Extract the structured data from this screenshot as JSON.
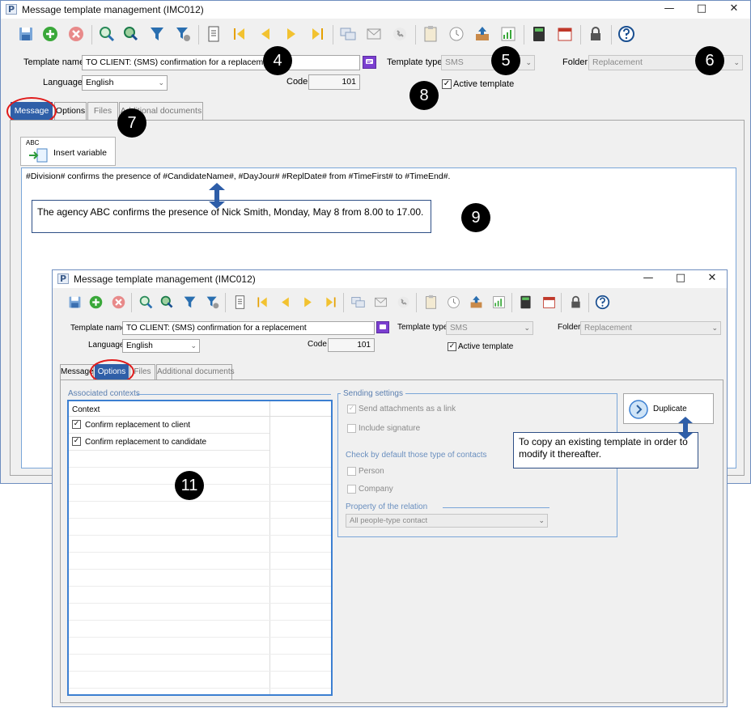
{
  "window1": {
    "title": "Message template management (IMC012)",
    "form": {
      "template_name_label": "Template name",
      "template_name_value": "TO CLIENT: (SMS) confirmation for a replacement",
      "template_type_label": "Template type",
      "template_type_value": "SMS",
      "folder_label": "Folder",
      "folder_value": "Replacement",
      "language_label": "Language",
      "language_value": "English",
      "code_label": "Code",
      "code_value": "101",
      "active_label": "Active template"
    },
    "tabs": [
      "Message",
      "Options",
      "Files",
      "Additional documents"
    ],
    "insert_variable_label": "Insert variable",
    "insert_variable_icon_text": "ABC",
    "message_text": "#Division# confirms the presence of #CandidateName#, #DayJour# #ReplDate# from #TimeFirst# to #TimeEnd#.",
    "preview_note": "The agency ABC confirms the presence of Nick Smith, Monday, May 8 from 8.00 to 17.00."
  },
  "window2": {
    "title": "Message template management (IMC012)",
    "form": {
      "template_name_label": "Template name",
      "template_name_value": "TO CLIENT: (SMS) confirmation for a replacement",
      "template_type_label": "Template type",
      "template_type_value": "SMS",
      "folder_label": "Folder",
      "folder_value": "Replacement",
      "language_label": "Language",
      "language_value": "English",
      "code_label": "Code",
      "code_value": "101",
      "active_label": "Active template"
    },
    "tabs": [
      "Message",
      "Options",
      "Files",
      "Additional documents"
    ],
    "associated_contexts_title": "Associated contexts",
    "context_header": "Context",
    "contexts": [
      {
        "label": "Confirm replacement to client",
        "checked": true
      },
      {
        "label": "Confirm replacement to candidate",
        "checked": true
      }
    ],
    "sending_settings_title": "Sending settings",
    "send_attachments_label": "Send attachments as a link",
    "include_signature_label": "Include signature",
    "check_default_label": "Check by default those type of contacts",
    "person_label": "Person",
    "company_label": "Company",
    "property_relation_label": "Property of the relation",
    "property_relation_value": "All people-type contact",
    "duplicate_label": "Duplicate",
    "duplicate_note": "To copy an existing template in order to modify it thereafter."
  },
  "callouts": {
    "c4": "4",
    "c5": "5",
    "c6": "6",
    "c7": "7",
    "c8": "8",
    "c9": "9",
    "c11": "11"
  },
  "colors": {
    "active_tab": "#2f5fa8",
    "window_border": "#6e8ebf",
    "highlight_ring": "#e01b1b",
    "note_border": "#2e4f86"
  }
}
